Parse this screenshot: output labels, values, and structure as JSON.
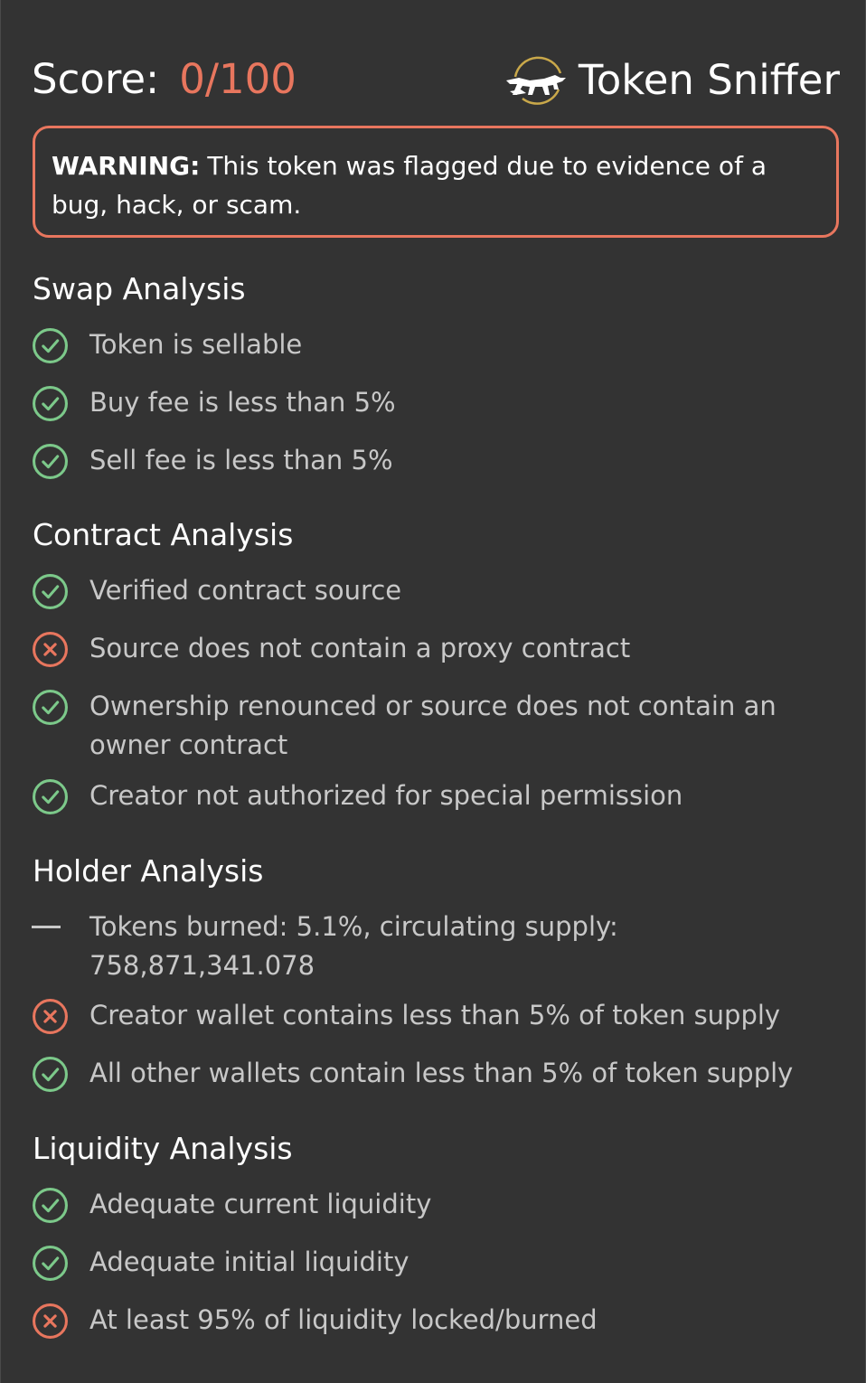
{
  "header": {
    "score_label": "Score:",
    "score_value": "0/100",
    "brand_name": "Token Sniffer",
    "brand_logo_icon": "panther-logo"
  },
  "warning": {
    "label": "WARNING:",
    "message": "This token was flagged due to evidence of a bug, hack, or scam."
  },
  "colors": {
    "background": "#333333",
    "pass": "#7cc98a",
    "fail": "#e8765e",
    "text": "#c8c8c8"
  },
  "sections": {
    "swap": {
      "title": "Swap Analysis",
      "items": [
        {
          "status": "pass",
          "icon": "check-circle-icon",
          "text": "Token is sellable"
        },
        {
          "status": "pass",
          "icon": "check-circle-icon",
          "text": "Buy fee is less than 5%"
        },
        {
          "status": "pass",
          "icon": "check-circle-icon",
          "text": "Sell fee is less than 5%"
        }
      ]
    },
    "contract": {
      "title": "Contract Analysis",
      "items": [
        {
          "status": "pass",
          "icon": "check-circle-icon",
          "text": "Verified contract source"
        },
        {
          "status": "fail",
          "icon": "x-circle-icon",
          "text": "Source does not contain a proxy contract"
        },
        {
          "status": "pass",
          "icon": "check-circle-icon",
          "text": "Ownership renounced or source does not contain an owner contract"
        },
        {
          "status": "pass",
          "icon": "check-circle-icon",
          "text": "Creator not authorized for special permission"
        }
      ]
    },
    "holder": {
      "title": "Holder Analysis",
      "items": [
        {
          "status": "neutral",
          "icon": "dash-icon",
          "text": "Tokens burned: 5.1%, circulating supply: 758,871,341.078"
        },
        {
          "status": "fail",
          "icon": "x-circle-icon",
          "text": "Creator wallet contains less than 5% of token supply"
        },
        {
          "status": "pass",
          "icon": "check-circle-icon",
          "text": "All other wallets contain less than 5% of token supply"
        }
      ]
    },
    "liquidity": {
      "title": "Liquidity Analysis",
      "items": [
        {
          "status": "pass",
          "icon": "check-circle-icon",
          "text": "Adequate current liquidity"
        },
        {
          "status": "pass",
          "icon": "check-circle-icon",
          "text": "Adequate initial liquidity"
        },
        {
          "status": "fail",
          "icon": "x-circle-icon",
          "text": "At least 95% of liquidity locked/burned"
        }
      ]
    }
  }
}
